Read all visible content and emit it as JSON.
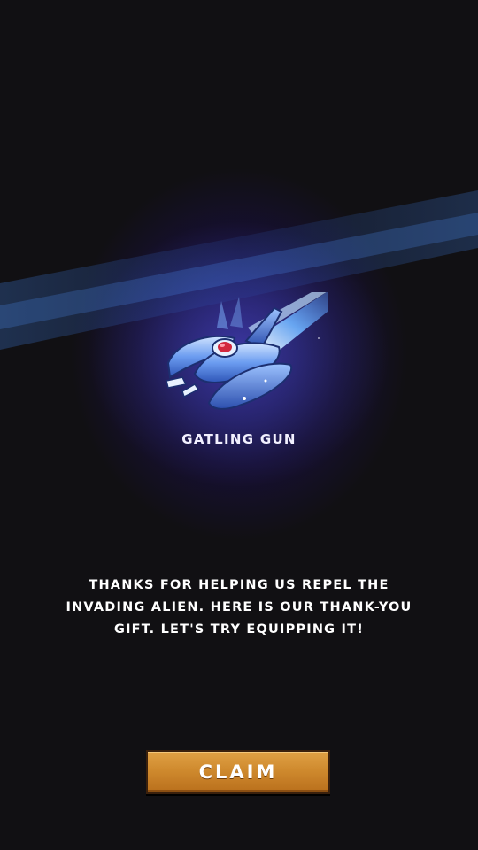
{
  "reward": {
    "item_name": "GATLING GUN",
    "item_icon": "gatling-gun-ship-icon"
  },
  "dialog": {
    "message": "THANKS FOR HELPING US REPEL THE\nINVADING ALIEN. HERE IS OUR THANK-YOU\nGIFT. LET'S TRY EQUIPPING IT!"
  },
  "actions": {
    "claim_label": "CLAIM"
  },
  "colors": {
    "background": "#111013",
    "glow": "#2a1a6e",
    "button": "#cf8a2e",
    "text": "#ffffff"
  }
}
